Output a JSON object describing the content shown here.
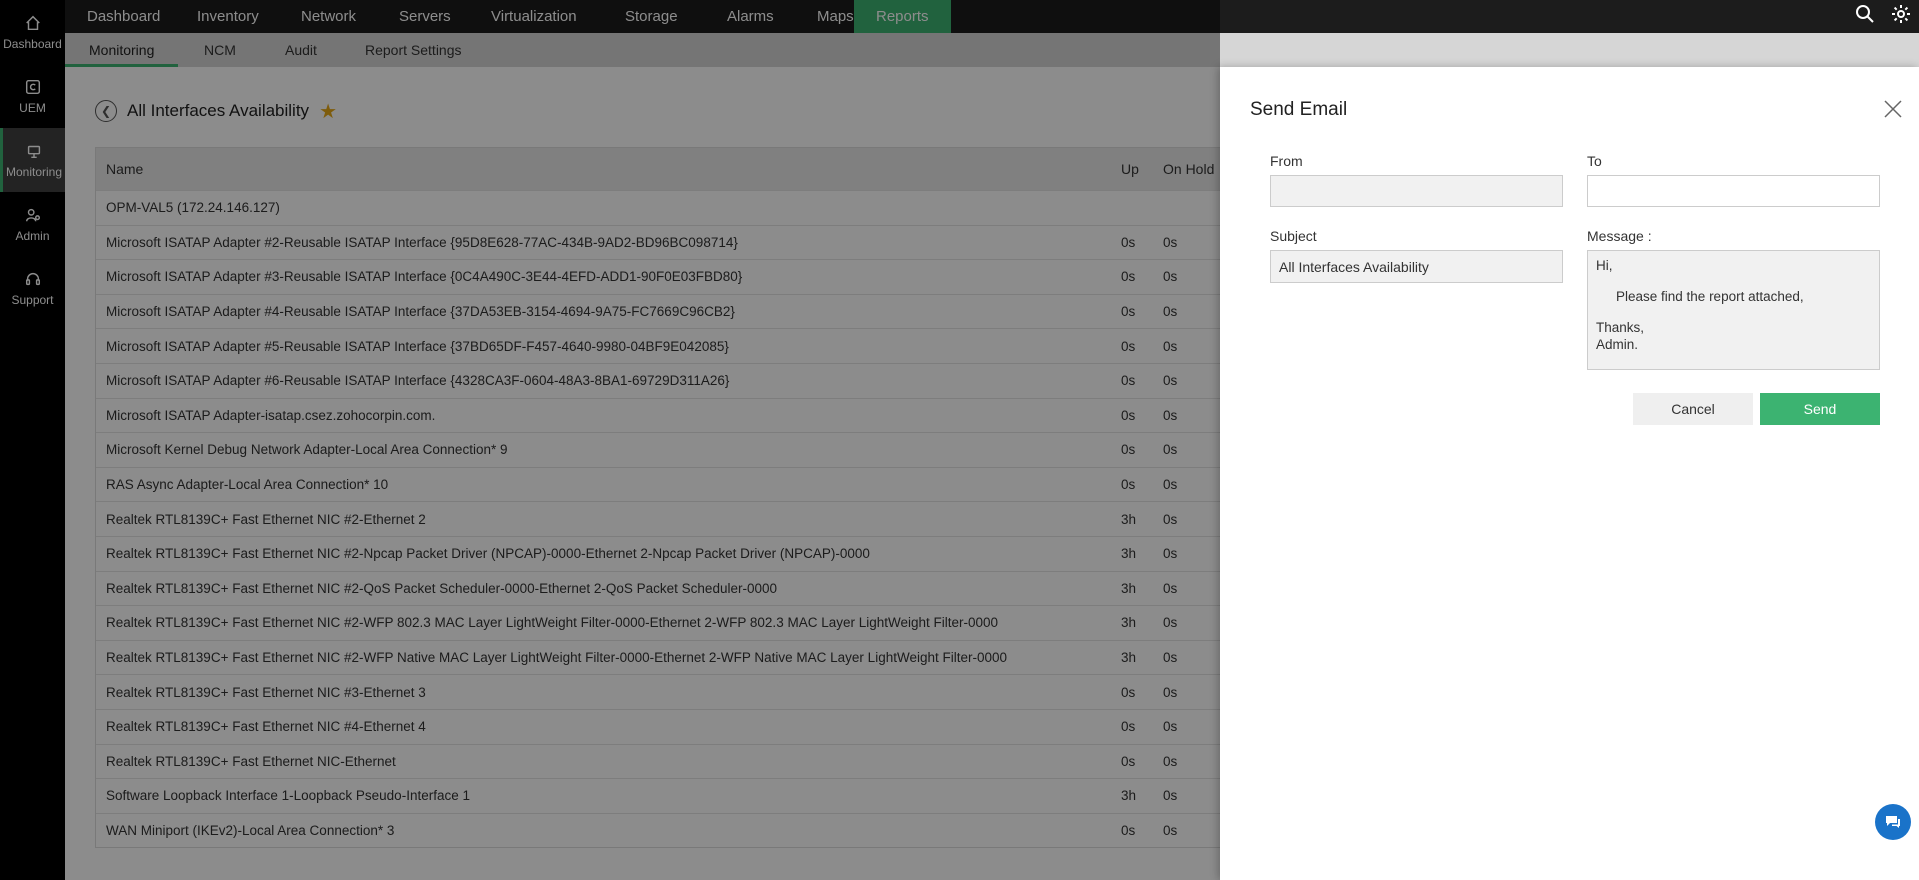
{
  "sidebar": {
    "items": [
      {
        "label": "Dashboard",
        "icon": "home-icon"
      },
      {
        "label": "UEM",
        "icon": "uem-icon"
      },
      {
        "label": "Monitoring",
        "icon": "monitoring-icon",
        "active": true
      },
      {
        "label": "Admin",
        "icon": "admin-icon"
      },
      {
        "label": "Support",
        "icon": "headset-icon"
      }
    ]
  },
  "topnav": {
    "items": [
      "Dashboard",
      "Inventory",
      "Network",
      "Servers",
      "Virtualization",
      "Storage",
      "Alarms",
      "Maps",
      "Reports"
    ],
    "active": "Reports"
  },
  "subnav": {
    "items": [
      "Monitoring",
      "NCM",
      "Audit",
      "Report Settings"
    ],
    "active": "Monitoring"
  },
  "page": {
    "title": "All Interfaces Availability"
  },
  "table": {
    "headers": {
      "name": "Name",
      "up": "Up",
      "hold": "On Hold"
    },
    "group": "OPM-VAL5 (172.24.146.127)",
    "rows": [
      {
        "name": "Microsoft ISATAP Adapter #2-Reusable ISATAP Interface {95D8E628-77AC-434B-9AD2-BD96BC098714}",
        "up": "0s",
        "hold": "0s"
      },
      {
        "name": "Microsoft ISATAP Adapter #3-Reusable ISATAP Interface {0C4A490C-3E44-4EFD-ADD1-90F0E03FBD80}",
        "up": "0s",
        "hold": "0s"
      },
      {
        "name": "Microsoft ISATAP Adapter #4-Reusable ISATAP Interface {37DA53EB-3154-4694-9A75-FC7669C96CB2}",
        "up": "0s",
        "hold": "0s"
      },
      {
        "name": "Microsoft ISATAP Adapter #5-Reusable ISATAP Interface {37BD65DF-F457-4640-9980-04BF9E042085}",
        "up": "0s",
        "hold": "0s"
      },
      {
        "name": "Microsoft ISATAP Adapter #6-Reusable ISATAP Interface {4328CA3F-0604-48A3-8BA1-69729D311A26}",
        "up": "0s",
        "hold": "0s"
      },
      {
        "name": "Microsoft ISATAP Adapter-isatap.csez.zohocorpin.com.",
        "up": "0s",
        "hold": "0s"
      },
      {
        "name": "Microsoft Kernel Debug Network Adapter-Local Area Connection* 9",
        "up": "0s",
        "hold": "0s"
      },
      {
        "name": "RAS Async Adapter-Local Area Connection* 10",
        "up": "0s",
        "hold": "0s"
      },
      {
        "name": "Realtek RTL8139C+ Fast Ethernet NIC #2-Ethernet 2",
        "up": "3h",
        "hold": "0s"
      },
      {
        "name": "Realtek RTL8139C+ Fast Ethernet NIC #2-Npcap Packet Driver (NPCAP)-0000-Ethernet 2-Npcap Packet Driver (NPCAP)-0000",
        "up": "3h",
        "hold": "0s"
      },
      {
        "name": "Realtek RTL8139C+ Fast Ethernet NIC #2-QoS Packet Scheduler-0000-Ethernet 2-QoS Packet Scheduler-0000",
        "up": "3h",
        "hold": "0s"
      },
      {
        "name": "Realtek RTL8139C+ Fast Ethernet NIC #2-WFP 802.3 MAC Layer LightWeight Filter-0000-Ethernet 2-WFP 802.3 MAC Layer LightWeight Filter-0000",
        "up": "3h",
        "hold": "0s"
      },
      {
        "name": "Realtek RTL8139C+ Fast Ethernet NIC #2-WFP Native MAC Layer LightWeight Filter-0000-Ethernet 2-WFP Native MAC Layer LightWeight Filter-0000",
        "up": "3h",
        "hold": "0s"
      },
      {
        "name": "Realtek RTL8139C+ Fast Ethernet NIC #3-Ethernet 3",
        "up": "0s",
        "hold": "0s"
      },
      {
        "name": "Realtek RTL8139C+ Fast Ethernet NIC #4-Ethernet 4",
        "up": "0s",
        "hold": "0s"
      },
      {
        "name": "Realtek RTL8139C+ Fast Ethernet NIC-Ethernet",
        "up": "0s",
        "hold": "0s"
      },
      {
        "name": "Software Loopback Interface 1-Loopback Pseudo-Interface 1",
        "up": "3h",
        "hold": "0s"
      },
      {
        "name": "WAN Miniport (IKEv2)-Local Area Connection* 3",
        "up": "0s",
        "hold": "0s"
      }
    ]
  },
  "email": {
    "title": "Send Email",
    "from_label": "From",
    "from_value": "",
    "to_label": "To",
    "to_value": "",
    "subject_label": "Subject",
    "subject_value": "All Interfaces Availability",
    "message_label": "Message :",
    "message_lines": [
      "Hi,",
      "",
      "Please find the report attached,",
      "",
      "Thanks,",
      "Admin."
    ],
    "cancel_label": "Cancel",
    "send_label": "Send"
  },
  "colors": {
    "accent": "#3cb371",
    "nav_bg": "#1c1c1c",
    "sidebar_bg": "#000000",
    "star": "#e6a817",
    "chat": "#1a73c9"
  }
}
